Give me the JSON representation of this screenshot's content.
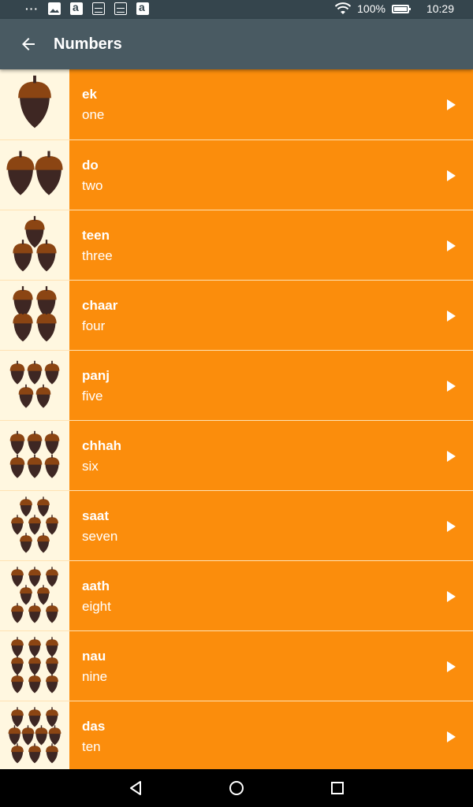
{
  "status_bar": {
    "battery": "100%",
    "time": "10:29",
    "notification_icons": [
      "more-dots-icon",
      "gallery-icon",
      "amazon-icon",
      "amazon-shop-icon",
      "amazon-shop-icon",
      "amazon-icon"
    ]
  },
  "app_bar": {
    "title": "Numbers",
    "back_icon": "arrow-back-icon"
  },
  "colors": {
    "status_bar": "#35454d",
    "app_bar": "#495a62",
    "row_background": "#fb8d0c",
    "thumb_background": "#fff7e0",
    "acorn_cap": "#8b4513",
    "acorn_body": "#3e2723"
  },
  "items": [
    {
      "word": "ek",
      "translation": "one",
      "count": 1
    },
    {
      "word": "do",
      "translation": "two",
      "count": 2
    },
    {
      "word": "teen",
      "translation": "three",
      "count": 3
    },
    {
      "word": "chaar",
      "translation": "four",
      "count": 4
    },
    {
      "word": "panj",
      "translation": "five",
      "count": 5
    },
    {
      "word": "chhah",
      "translation": "six",
      "count": 6
    },
    {
      "word": "saat",
      "translation": "seven",
      "count": 7
    },
    {
      "word": "aath",
      "translation": "eight",
      "count": 8
    },
    {
      "word": "nau",
      "translation": "nine",
      "count": 9
    },
    {
      "word": "das",
      "translation": "ten",
      "count": 10
    }
  ],
  "nav_bar": {
    "buttons": [
      "back-triangle-icon",
      "home-circle-icon",
      "recents-square-icon"
    ]
  }
}
